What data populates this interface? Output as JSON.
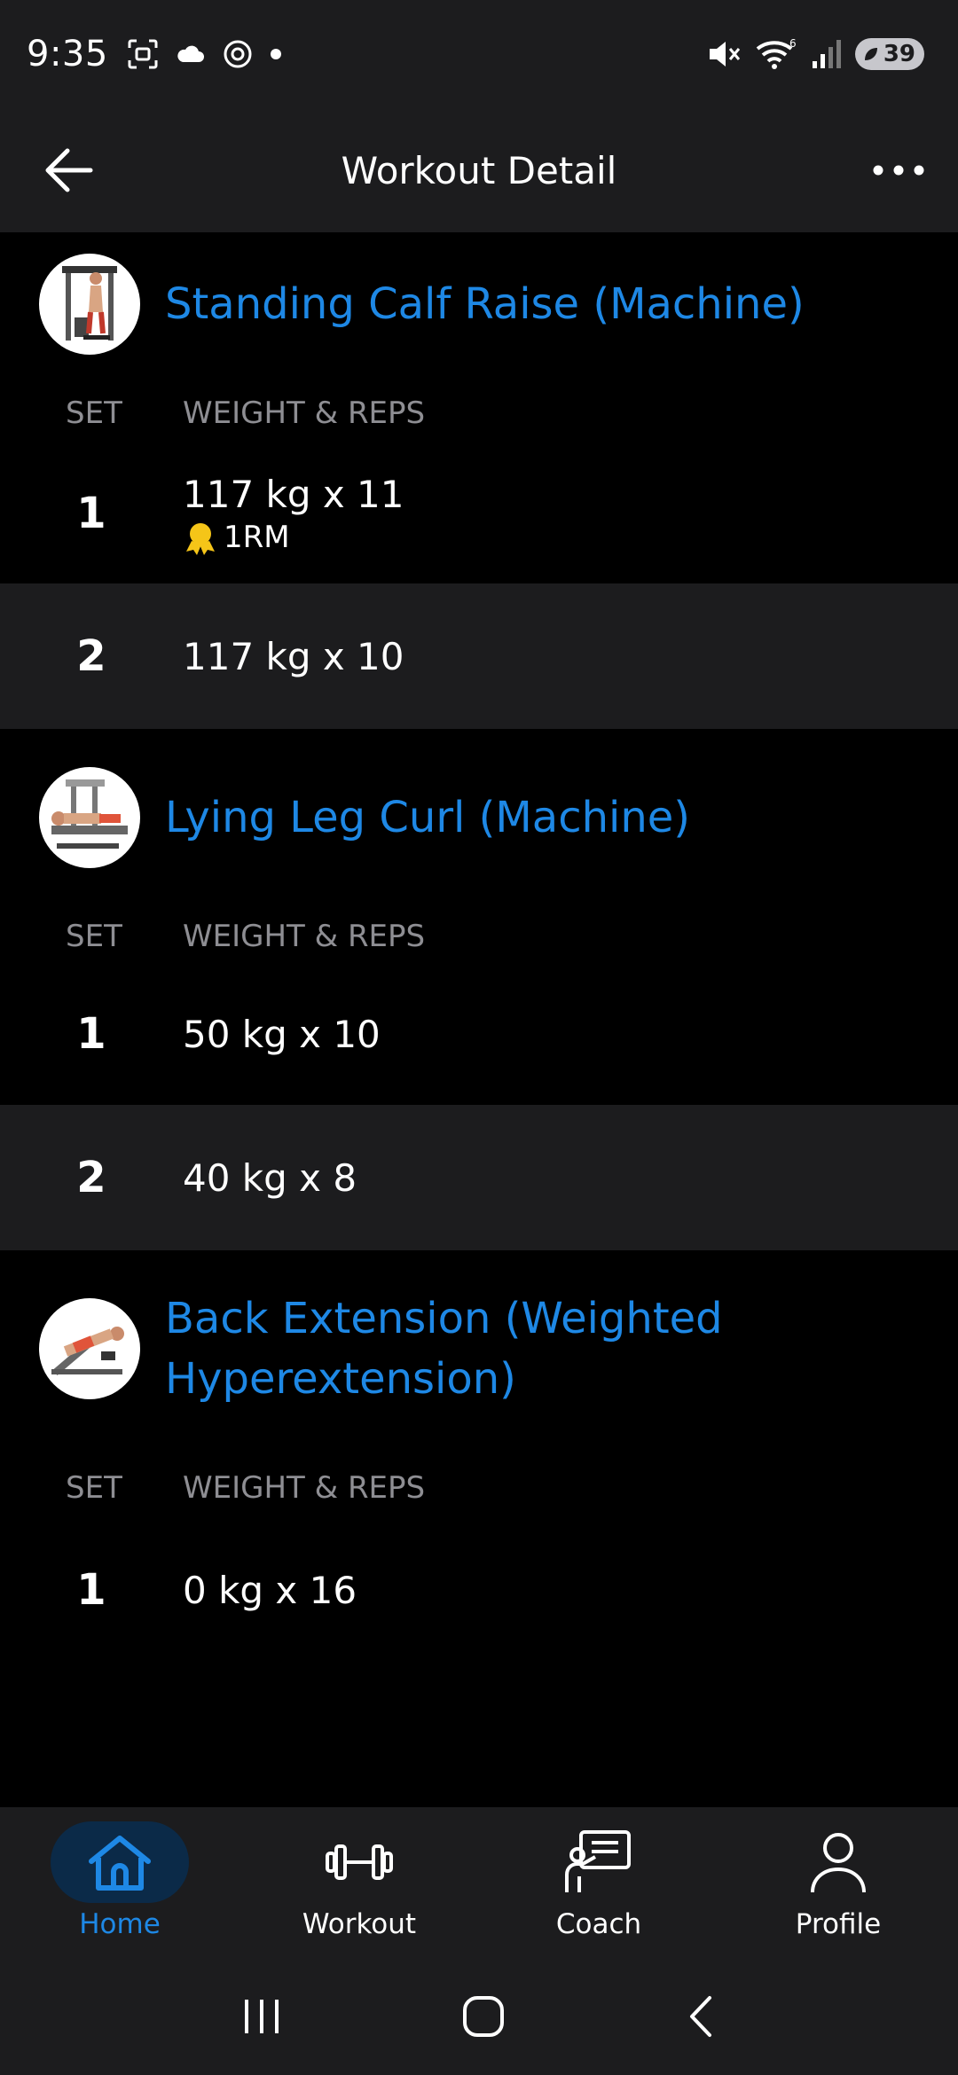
{
  "status_bar": {
    "time": "9:35",
    "battery": "39",
    "wifi_badge": "6"
  },
  "header": {
    "title": "Workout Detail"
  },
  "columns": {
    "set": "SET",
    "weight_reps": "WEIGHT & REPS"
  },
  "exercises": [
    {
      "title": "Standing Calf Raise (Machine)",
      "sets": [
        {
          "set": "1",
          "value": "117 kg x 11",
          "badge": "1RM"
        },
        {
          "set": "2",
          "value": "117 kg x 10"
        }
      ]
    },
    {
      "title": "Lying Leg Curl (Machine)",
      "sets": [
        {
          "set": "1",
          "value": "50 kg x 10"
        },
        {
          "set": "2",
          "value": "40 kg x 8"
        }
      ]
    },
    {
      "title_line1": "Back Extension (Weighted",
      "title_line2": "Hyperextension)",
      "sets": [
        {
          "set": "1",
          "value": "0 kg x 16"
        }
      ]
    }
  ],
  "nav": {
    "home": "Home",
    "workout": "Workout",
    "coach": "Coach",
    "profile": "Profile"
  },
  "colors": {
    "accent": "#1e88e5",
    "surface": "#1c1c1e",
    "background": "#000000",
    "muted": "#8e8e93",
    "medal": "#f5c518"
  },
  "icons": [
    "arrow-left-icon",
    "more-horizontal-icon",
    "medal-icon",
    "home-icon",
    "dumbbell-icon",
    "coach-icon",
    "user-icon"
  ]
}
